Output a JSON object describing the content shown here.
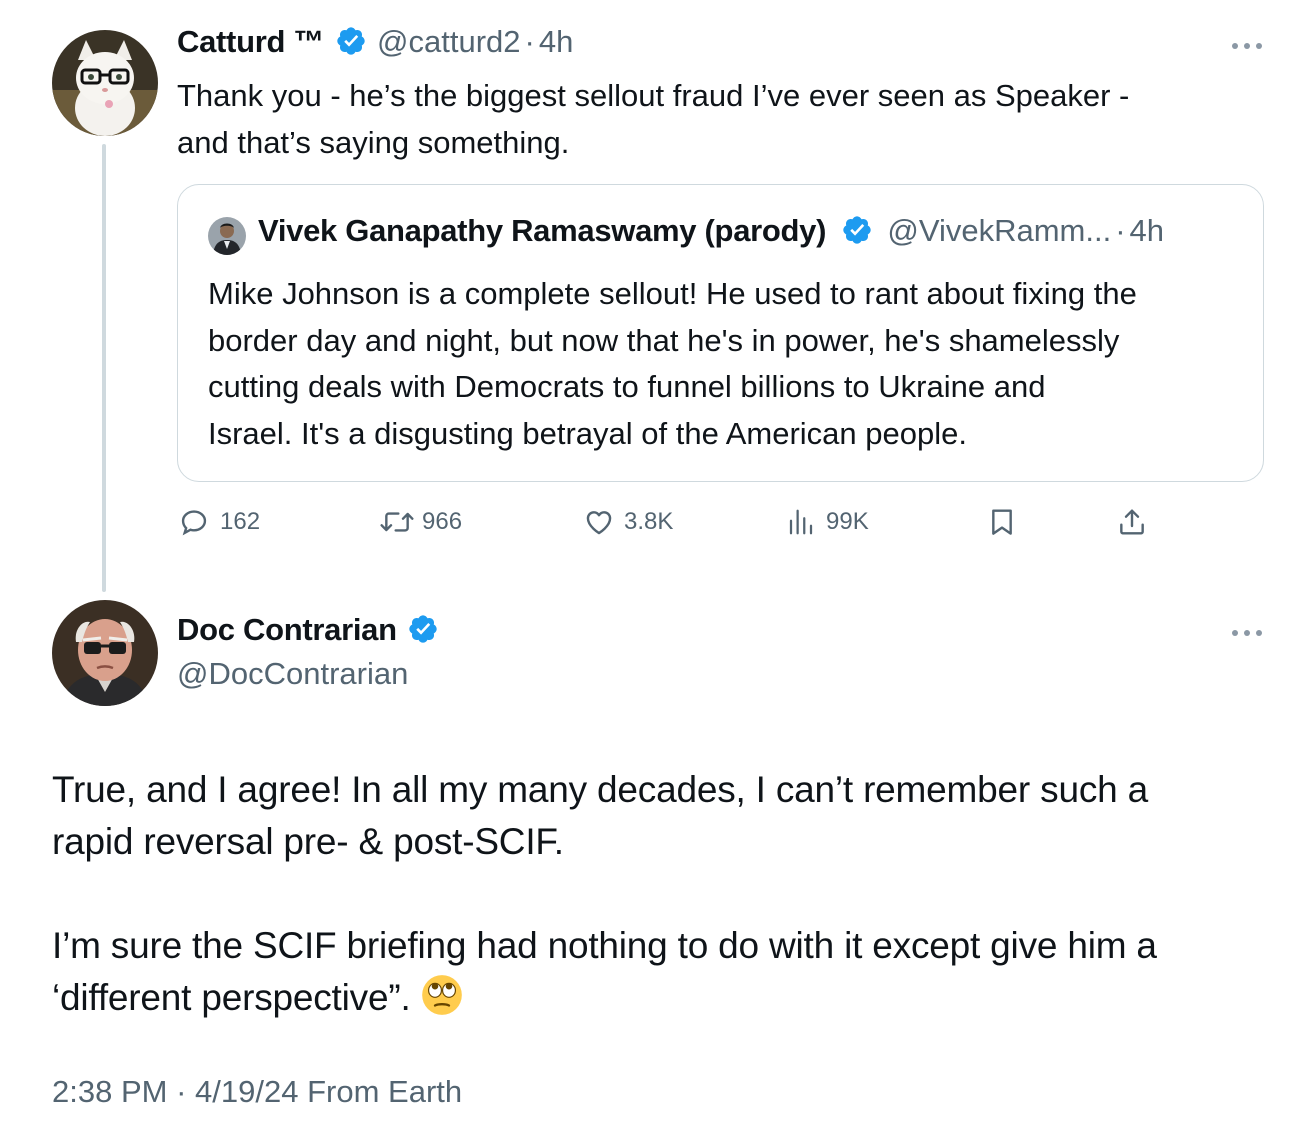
{
  "colors": {
    "text_primary": "#0f1419",
    "text_secondary": "#536471",
    "verified_blue": "#1d9bf0",
    "border": "#cfd9de"
  },
  "tweet1": {
    "name": "Catturd ™",
    "handle": "@catturd2",
    "separator": "·",
    "time": "4h",
    "text_line1": "Thank you - he’s the biggest sellout fraud I’ve ever seen as Speaker -",
    "text_line2": "and that’s saying something.",
    "avatar_icon": "cat-avatar",
    "quote": {
      "name": "Vivek Ganapathy Ramaswamy (parody)",
      "handle": "@VivekRamm...",
      "separator": "·",
      "time": "4h",
      "lines": [
        "Mike Johnson is a complete sellout! He used to rant about fixing the",
        "border day and night, but now that he's in power, he's shamelessly",
        "cutting deals with Democrats to funnel billions to Ukraine and",
        "Israel. It's a disgusting betrayal of the American people."
      ]
    },
    "actions": {
      "replies": "162",
      "reposts": "966",
      "likes": "3.8K",
      "views": "99K"
    }
  },
  "tweet2": {
    "name": "Doc Contrarian",
    "handle": "@DocContrarian",
    "text_line1": "True, and I agree! In all my many decades, I can’t remember such a",
    "text_line2": "rapid reversal pre- & post-SCIF.",
    "text_line3": "I’m sure the SCIF briefing had nothing to do with it except give him a",
    "text_line4": "‘different perspective”.",
    "emoji_icon": "face-with-rolling-eyes-icon",
    "meta": {
      "time": "2:38 PM",
      "separator": "·",
      "date": "4/19/24",
      "source": "From Earth"
    }
  }
}
